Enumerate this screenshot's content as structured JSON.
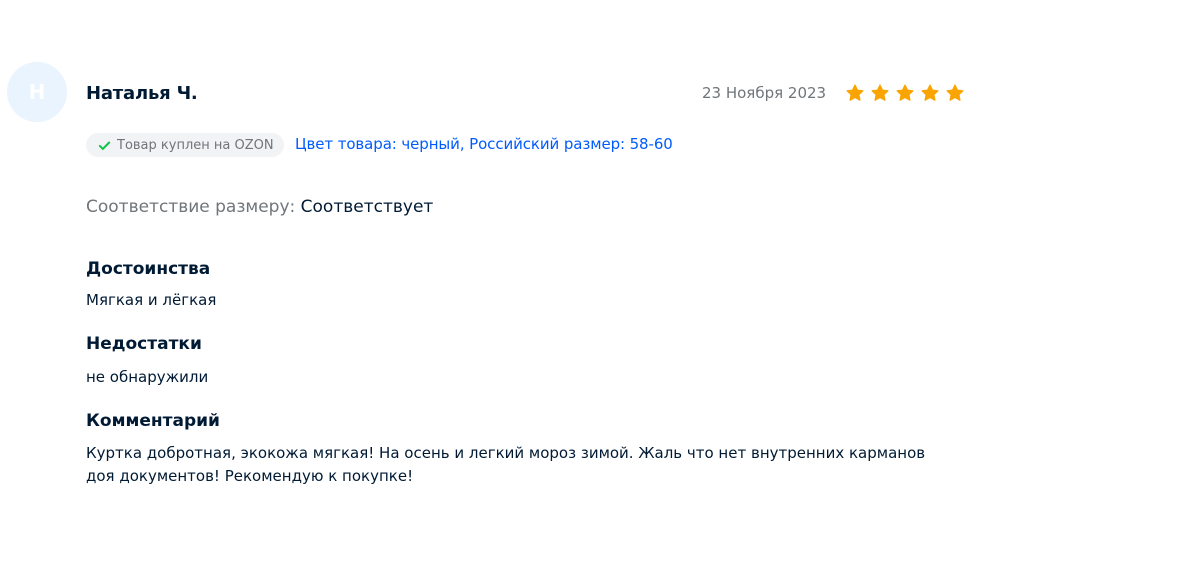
{
  "review": {
    "avatar_letter": "Н",
    "author": "Наталья Ч.",
    "date": "23 Ноября 2023",
    "rating": 5,
    "rating_max": 5,
    "star_color": "#f9a400",
    "badge": {
      "icon": "check-icon",
      "text": "Товар куплен на OZON"
    },
    "variant": "Цвет товара: черный, Российский размер: 58-60",
    "fit": {
      "label": "Соответствие размеру:",
      "value": "Соответствует"
    },
    "pros": {
      "title": "Достоинства",
      "text": "Мягкая и лёгкая"
    },
    "cons": {
      "title": "Недостатки",
      "text": "не обнаружили"
    },
    "comment": {
      "title": "Комментарий",
      "text": "Куртка добротная, экокожа мягкая! На осень и легкий мороз зимой. Жаль что нет внутренних карманов доя документов! Рекомендую к покупке!"
    }
  },
  "colors": {
    "link": "#005bff",
    "muted": "#70757a",
    "text": "#001a34",
    "check": "#10c44c"
  }
}
